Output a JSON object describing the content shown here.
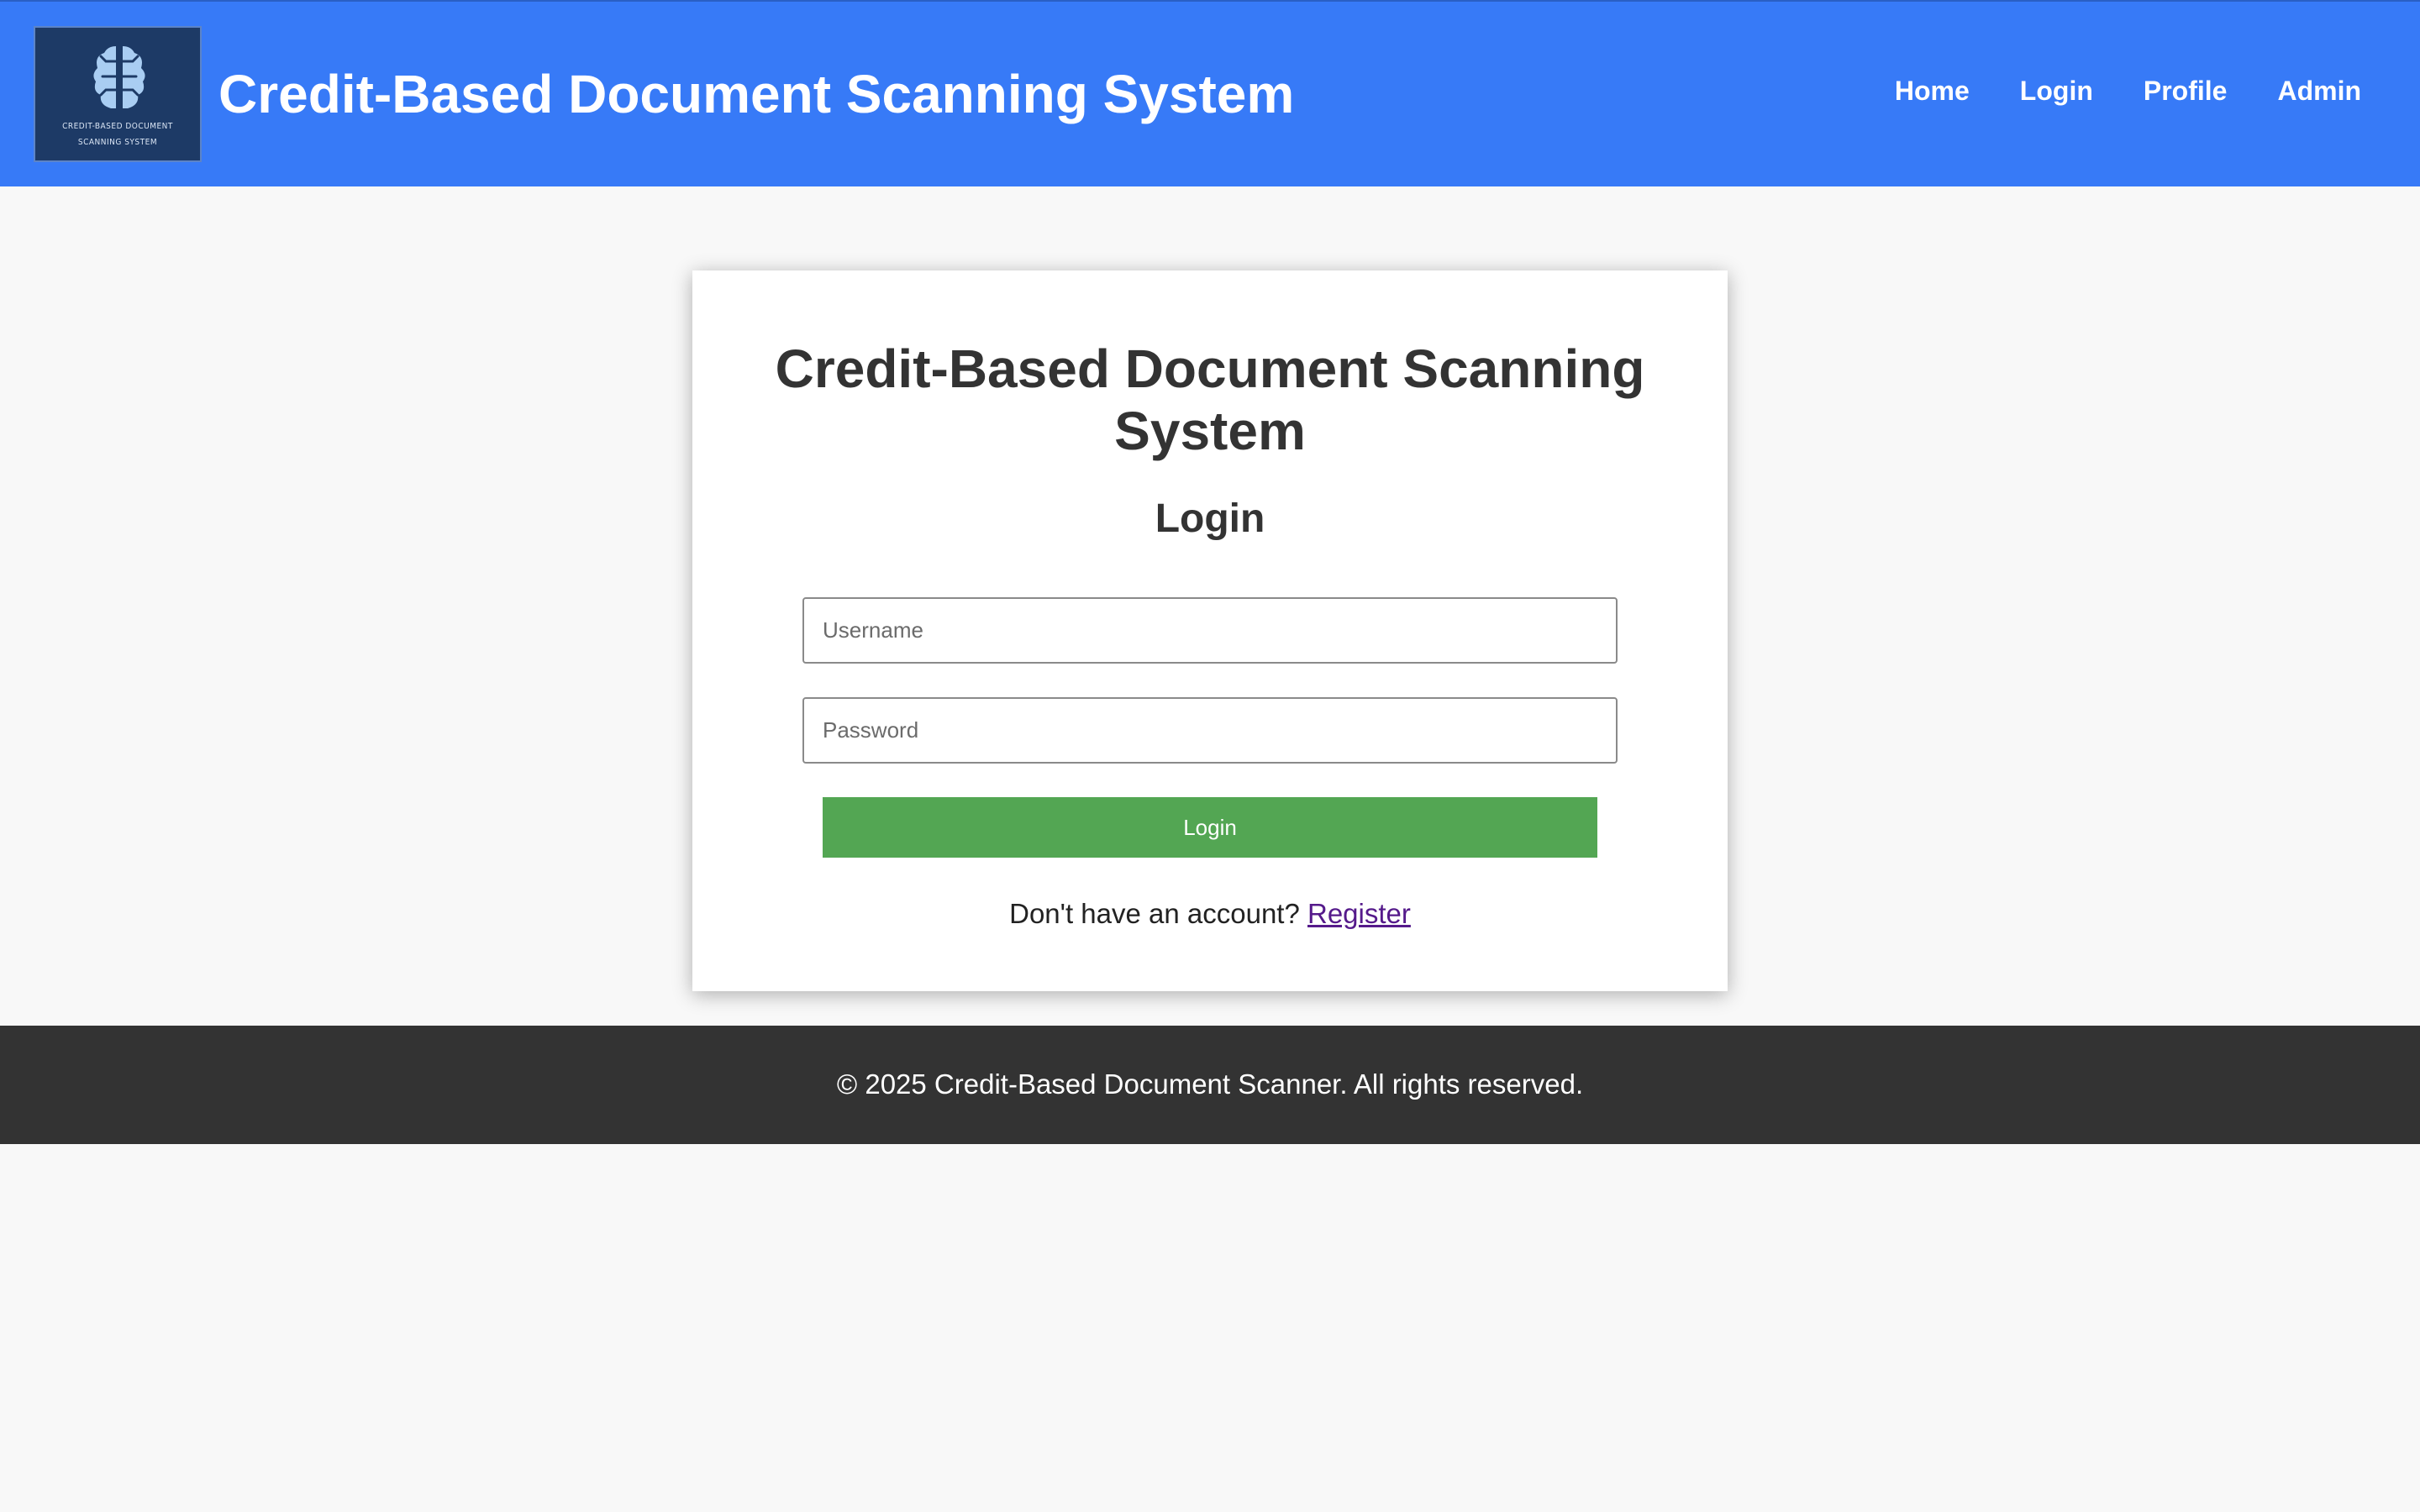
{
  "header": {
    "logo": {
      "icon": "brain-icon",
      "line1": "CREDIT-BASED DOCUMENT",
      "line2": "SCANNING SYSTEM"
    },
    "title": "Credit-Based Document Scanning System",
    "nav": [
      {
        "label": "Home"
      },
      {
        "label": "Login"
      },
      {
        "label": "Profile"
      },
      {
        "label": "Admin"
      }
    ]
  },
  "login_card": {
    "title": "Credit-Based Document Scanning System",
    "subtitle": "Login",
    "username": {
      "placeholder": "Username",
      "value": ""
    },
    "password": {
      "placeholder": "Password",
      "value": ""
    },
    "submit_label": "Login",
    "register_prompt": "Don't have an account?",
    "register_link": "Register"
  },
  "footer": {
    "text": "© 2025 Credit-Based Document Scanner. All rights reserved."
  },
  "colors": {
    "header_bg": "#377af7",
    "page_bg": "#f8f8f8",
    "button_bg": "#53a653",
    "footer_bg": "#333333",
    "link_visited": "#551a8b",
    "logo_bg": "#1d3a66"
  }
}
